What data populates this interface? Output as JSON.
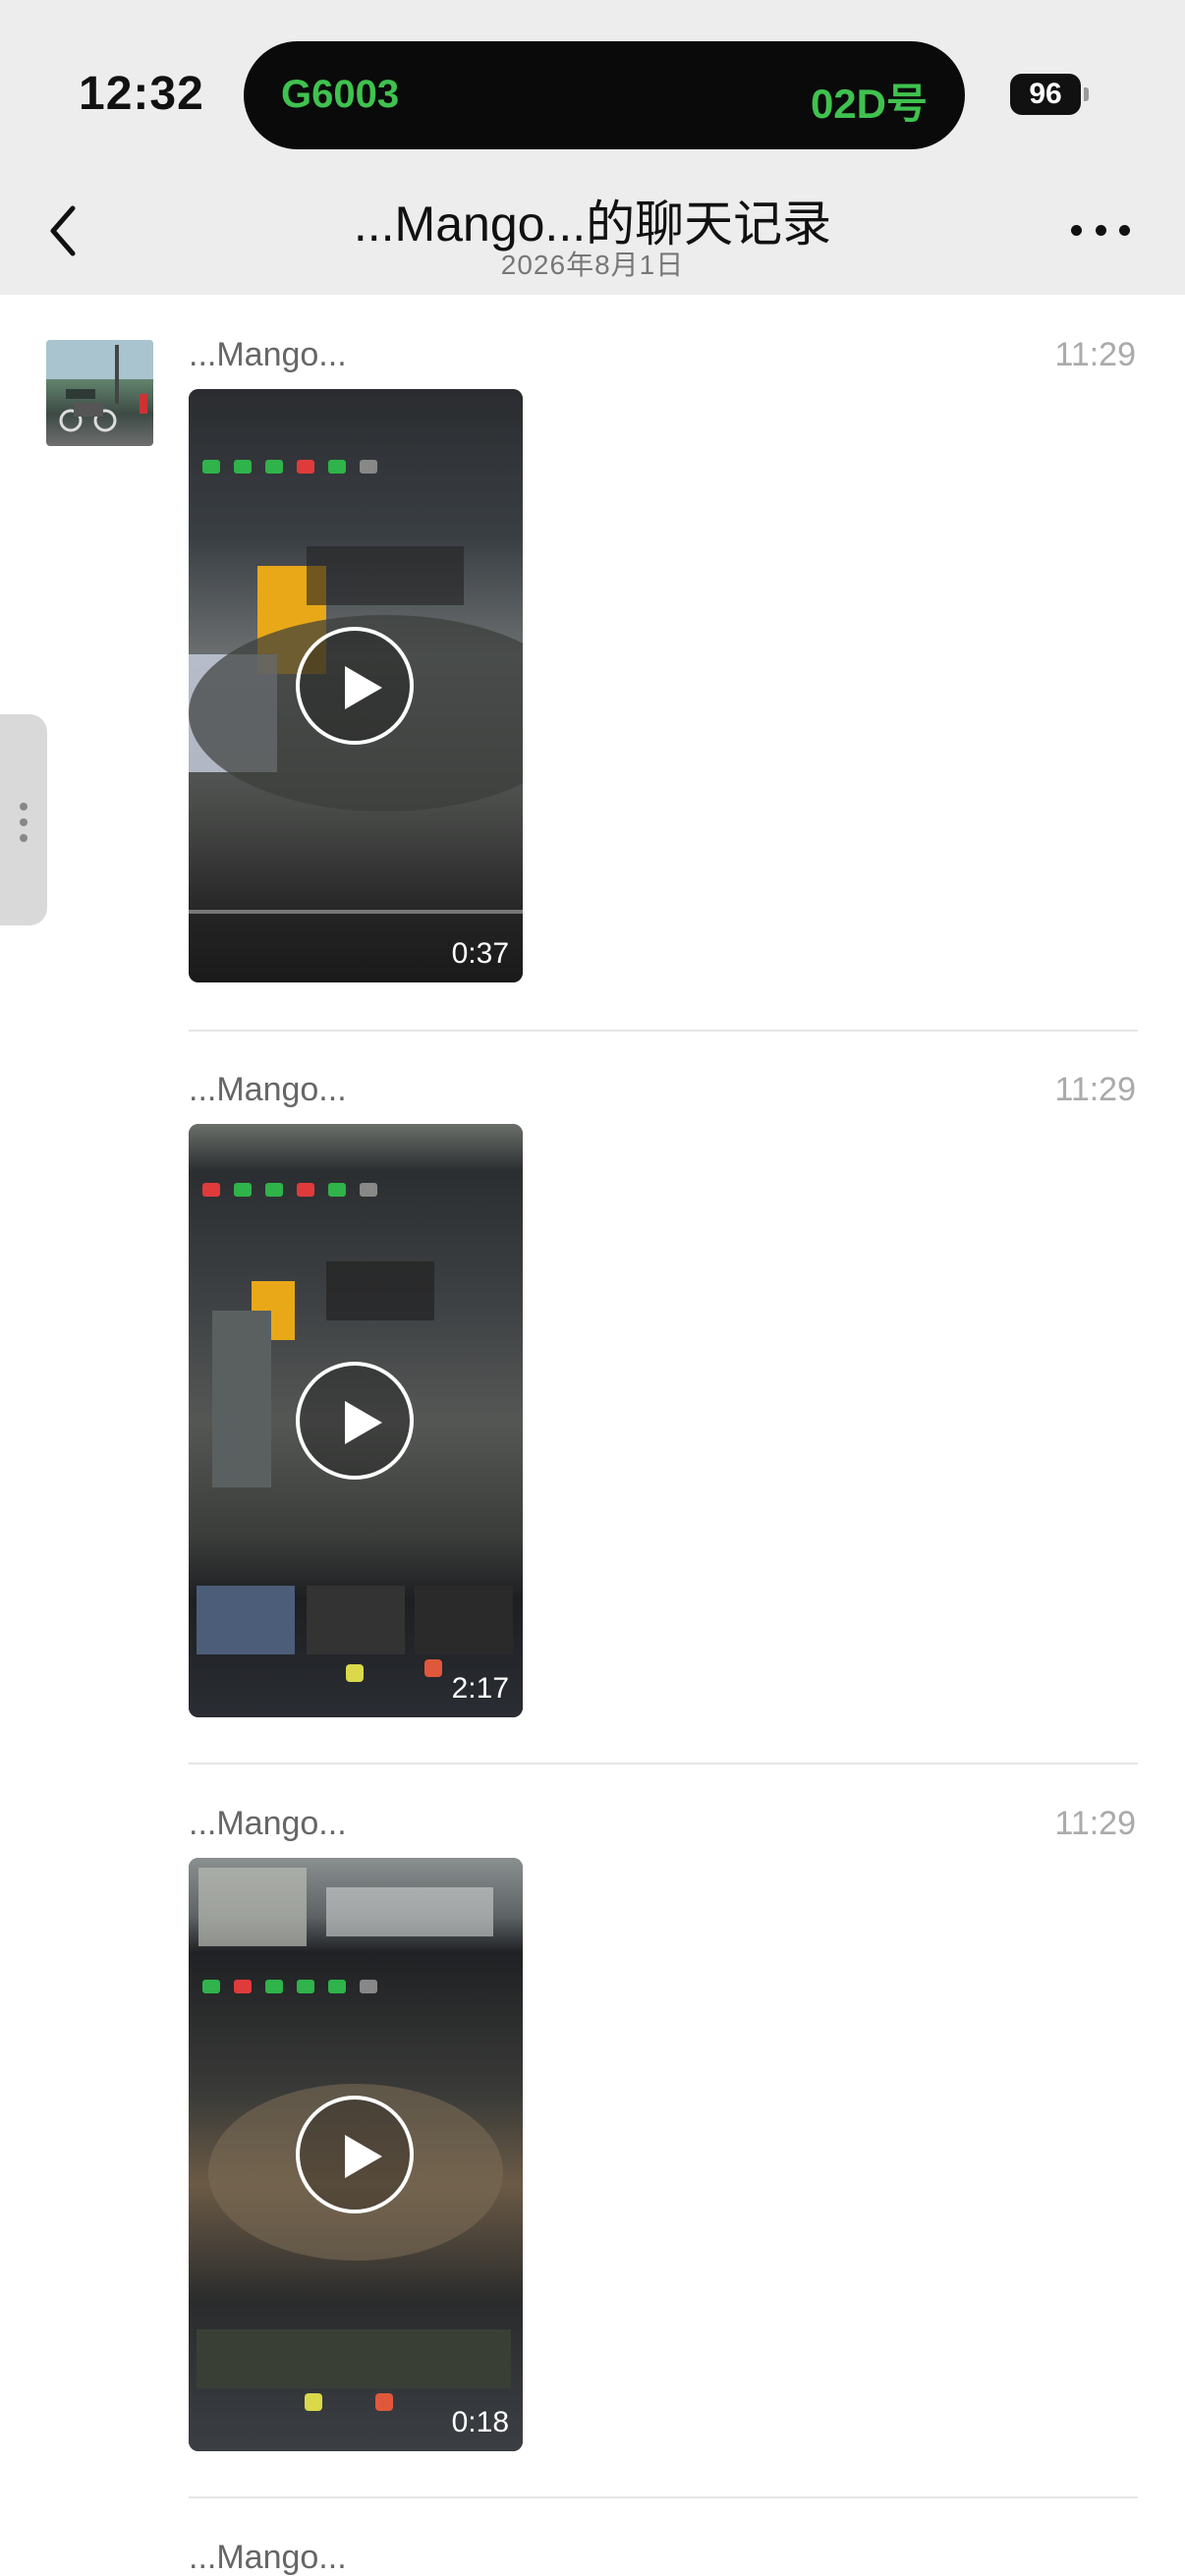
{
  "status_bar": {
    "time": "12:32",
    "island_left": "G6003",
    "island_right": "02D号",
    "battery": "96"
  },
  "header": {
    "title": "...Mango...的聊天记录",
    "date": "2026年8月1日"
  },
  "messages": [
    {
      "sender": "...Mango...",
      "time": "11:29",
      "duration": "0:37"
    },
    {
      "sender": "...Mango...",
      "time": "11:29",
      "duration": "2:17"
    },
    {
      "sender": "...Mango...",
      "time": "11:29",
      "duration": "0:18"
    },
    {
      "sender": "...Mango..."
    }
  ],
  "icons": [
    "back-chevron-icon",
    "more-dots-icon",
    "play-icon"
  ],
  "colors": {
    "accent": "#3fc24f",
    "header_bg": "#ededed"
  }
}
